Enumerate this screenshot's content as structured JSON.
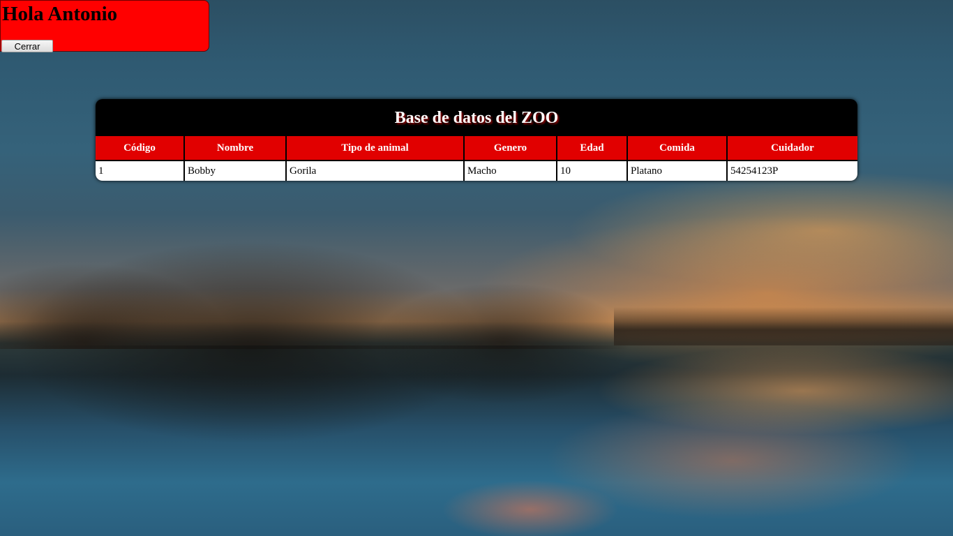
{
  "greeting": {
    "title": "Hola Antonio",
    "close_label": "Cerrar"
  },
  "zoo_table": {
    "title": "Base de datos del ZOO",
    "columns": [
      "Código",
      "Nombre",
      "Tipo de animal",
      "Genero",
      "Edad",
      "Comida",
      "Cuidador"
    ],
    "rows": [
      [
        "1",
        "Bobby",
        "Gorila",
        "Macho",
        "10",
        "Platano",
        "54254123P"
      ]
    ]
  },
  "colors": {
    "greeting_panel": "#ff0000",
    "header_cells": "#e10000",
    "card_background": "#000000"
  }
}
